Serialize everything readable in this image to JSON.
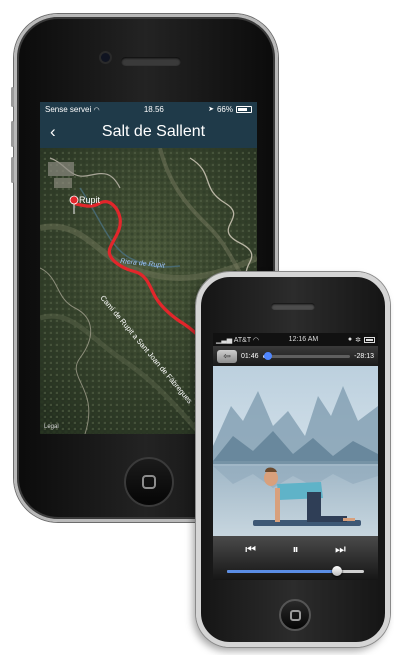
{
  "phone1": {
    "status": {
      "carrier": "Sense servei",
      "time": "18.56",
      "battery": "66%"
    },
    "nav": {
      "back_icon": "chevron-left-icon",
      "title": "Salt de Sallent"
    },
    "map": {
      "marker_label": "Rupit",
      "labels": [
        "Riera de Rupit",
        "Camí de Rupit a Sant Joan de Fàbregues"
      ],
      "attribution": "Legal",
      "route_color": "#e2262b"
    }
  },
  "phone2": {
    "status": {
      "carrier": "AT&T",
      "time": "12:16 AM"
    },
    "scrubber": {
      "elapsed": "01:46",
      "remaining": "-28:13",
      "progress_fraction": 0.06
    },
    "controls": {
      "prev_icon": "previous-track-icon",
      "pause_icon": "pause-icon",
      "next_icon": "next-track-icon"
    },
    "volume": {
      "level_fraction": 0.8
    },
    "accent_color": "#4f86ff"
  }
}
